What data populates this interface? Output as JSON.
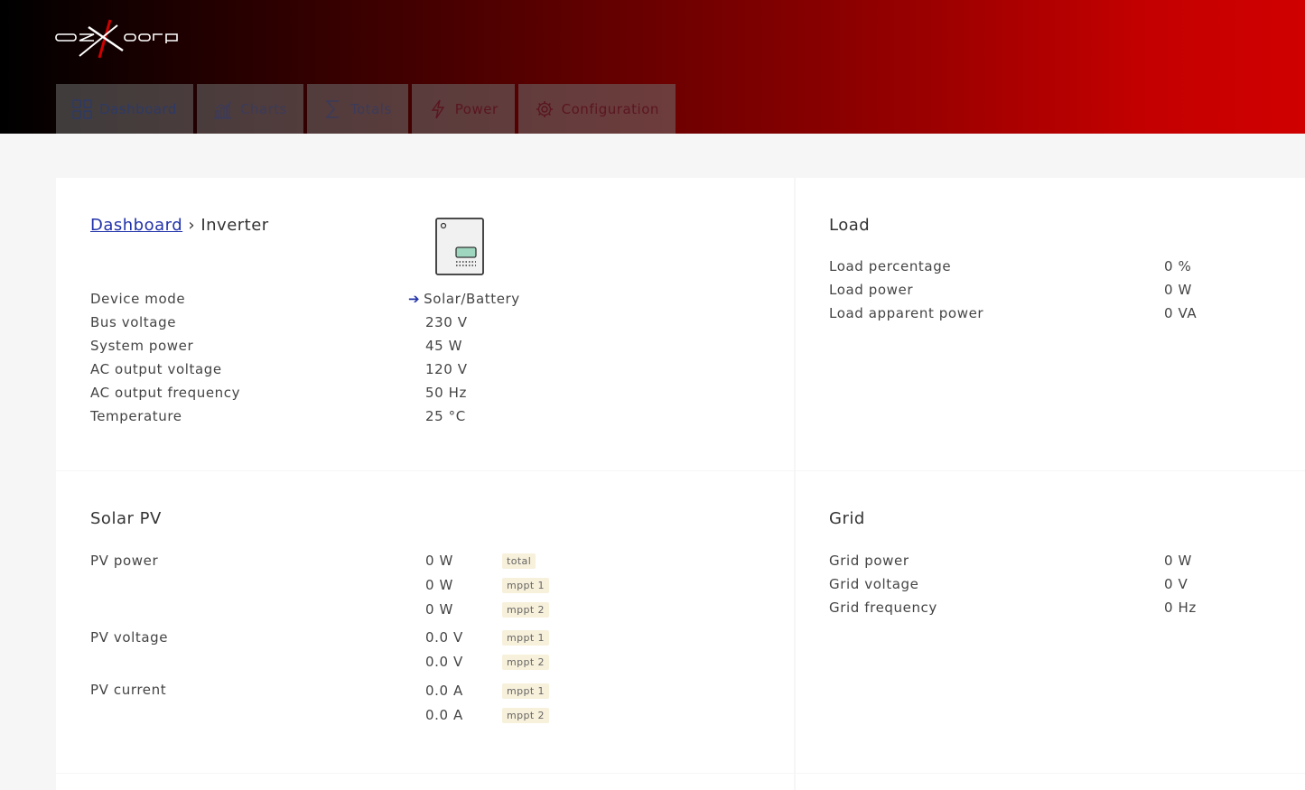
{
  "logo": {
    "text": "ozXcorp"
  },
  "nav": {
    "tabs": [
      {
        "label": "Dashboard",
        "icon": "grid-icon"
      },
      {
        "label": "Charts",
        "icon": "chart-icon"
      },
      {
        "label": "Totals",
        "icon": "sigma-icon"
      },
      {
        "label": "Power",
        "icon": "lightning-icon"
      },
      {
        "label": "Configuration",
        "icon": "gear-icon"
      }
    ]
  },
  "inverter": {
    "breadcrumb_link": "Dashboard",
    "breadcrumb_sep": "›",
    "title": "Inverter",
    "rows": [
      {
        "label": "Device mode",
        "value": "Solar/Battery"
      },
      {
        "label": "Bus voltage",
        "value": "230 V"
      },
      {
        "label": "System power",
        "value": "45 W"
      },
      {
        "label": "AC output voltage",
        "value": "120 V"
      },
      {
        "label": "AC output frequency",
        "value": "50 Hz"
      },
      {
        "label": "Temperature",
        "value": "25 °C"
      }
    ],
    "mode_arrow": "➔"
  },
  "load": {
    "title": "Load",
    "rows": [
      {
        "label": "Load percentage",
        "value": "0 %"
      },
      {
        "label": "Load power",
        "value": "0 W"
      },
      {
        "label": "Load apparent power",
        "value": "0 VA"
      }
    ]
  },
  "solar": {
    "title": "Solar PV",
    "pv_power_label": "PV power",
    "pv_power": [
      {
        "value": "0 W",
        "badge": "total"
      },
      {
        "value": "0 W",
        "badge": "mppt 1"
      },
      {
        "value": "0 W",
        "badge": "mppt 2"
      }
    ],
    "pv_voltage_label": "PV voltage",
    "pv_voltage": [
      {
        "value": "0.0 V",
        "badge": "mppt 1"
      },
      {
        "value": "0.0 V",
        "badge": "mppt 2"
      }
    ],
    "pv_current_label": "PV current",
    "pv_current": [
      {
        "value": "0.0 A",
        "badge": "mppt 1"
      },
      {
        "value": "0.0 A",
        "badge": "mppt 2"
      }
    ]
  },
  "grid": {
    "title": "Grid",
    "rows": [
      {
        "label": "Grid power",
        "value": "0 W"
      },
      {
        "label": "Grid voltage",
        "value": "0 V"
      },
      {
        "label": "Grid frequency",
        "value": "0 Hz"
      }
    ]
  },
  "colors": {
    "header_dark": "#000000",
    "header_red": "#d00000",
    "link_blue": "#2233aa",
    "badge_bg": "#f7f0da"
  }
}
